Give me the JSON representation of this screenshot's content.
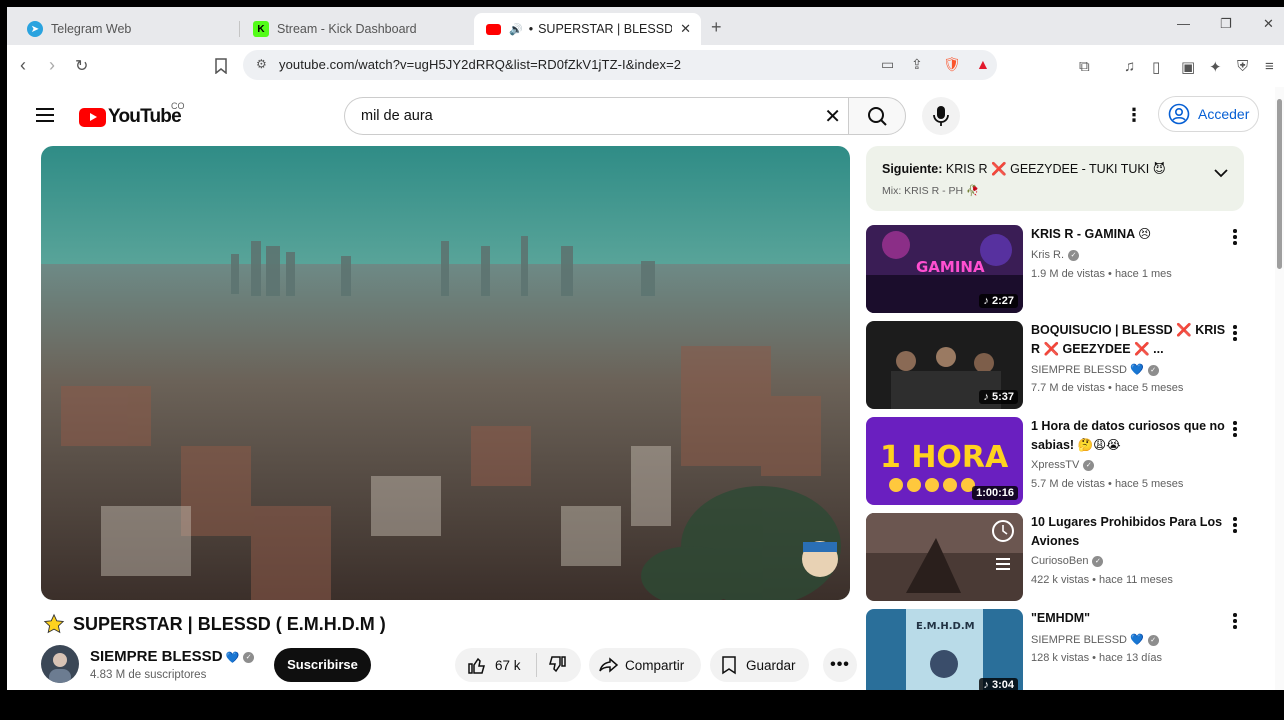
{
  "browser": {
    "tabs": [
      {
        "label": "Telegram Web",
        "icon": "telegram-icon",
        "color": "#2aa3df"
      },
      {
        "label": "Stream - Kick Dashboard",
        "icon": "kick-icon",
        "color": "#53fc18"
      },
      {
        "label": "SUPERSTAR | BLESSD ( E.M",
        "icon": "youtube-icon",
        "color": "#ff0000",
        "active": true
      }
    ],
    "new_tab": "+",
    "url": "youtube.com/watch?v=ugH5JY2dRRQ&list=RD0fZkV1jTZ-I&index=2",
    "window_controls": {
      "minimize": "—",
      "restore": "❐",
      "close": "✕"
    }
  },
  "youtube": {
    "logo_text": "YouTube",
    "country": "CO",
    "search_query": "mil de aura",
    "sign_in": "Acceder"
  },
  "video": {
    "title": "SUPERSTAR | BLESSD ( E.M.H.D.M )",
    "channel": "SIEMPRE BLESSD",
    "subscribers": "4.83 M de suscriptores",
    "subscribe_label": "Suscribirse",
    "likes": "67 k",
    "share_label": "Compartir",
    "save_label": "Guardar"
  },
  "up_next": {
    "label": "Siguiente:",
    "title": "KRIS R ❌ GEEZYDEE - TUKI TUKI 😈",
    "mix": "Mix: KRIS R - PH 🥀"
  },
  "recommendations": [
    {
      "title": "KRIS R - GAMINA 😣",
      "channel": "Kris R.",
      "meta": "1.9 M de vistas • hace 1 mes",
      "duration": "♪ 2:27",
      "heart": false
    },
    {
      "title": "BOQUISUCIO | BLESSD ❌ KRIS R ❌ GEEZYDEE ❌ ...",
      "channel": "SIEMPRE BLESSD",
      "meta": "7.7 M de vistas • hace 5 meses",
      "duration": "♪ 5:37",
      "heart": true
    },
    {
      "title": "1 Hora de datos curiosos que no sabias! 🤔😩😭",
      "channel": "XpressTV",
      "meta": "5.7 M de vistas • hace 5 meses",
      "duration": "1:00:16",
      "heart": false
    },
    {
      "title": "10 Lugares Prohibidos Para Los Aviones",
      "channel": "CuriosoBen",
      "meta": "422 k vistas • hace 11 meses",
      "duration": "",
      "heart": false
    },
    {
      "title": "\"EMHDM\"",
      "channel": "SIEMPRE BLESSD",
      "meta": "128 k vistas • hace 13 días",
      "duration": "♪ 3:04",
      "heart": true
    }
  ],
  "thumb_text": {
    "gamina": "GAMINA",
    "hora": "1 HORA",
    "emhdm": "E.M.H.D.M"
  }
}
